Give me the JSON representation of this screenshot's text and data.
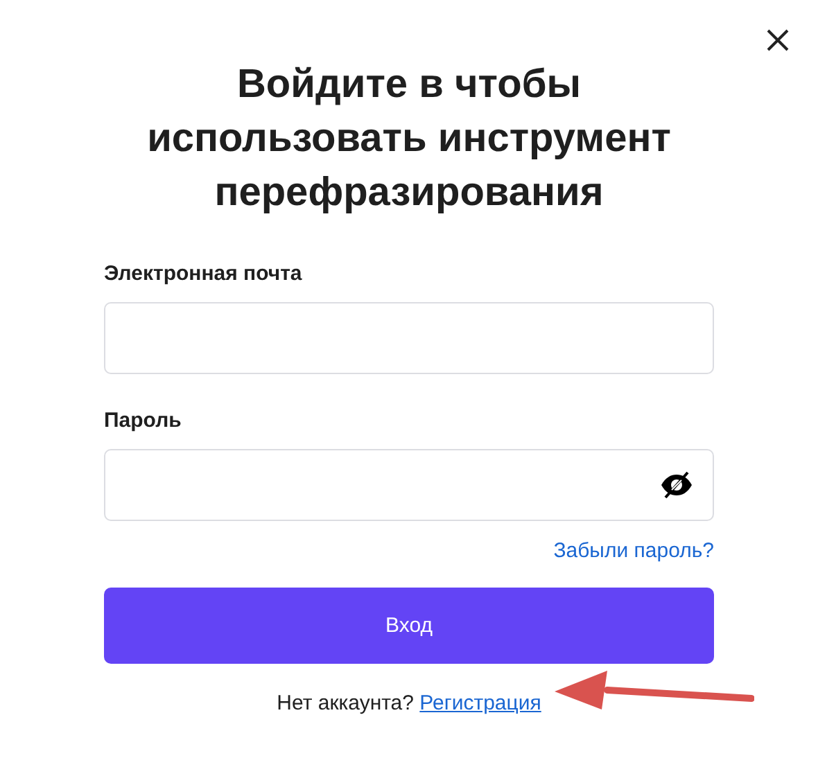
{
  "title": "Войдите в чтобы использовать инструмент перефразирования",
  "fields": [
    {
      "label": "Электронная почта",
      "kind": "email"
    },
    {
      "label": "Пароль",
      "kind": "password",
      "password_visible": false
    }
  ],
  "forgot_link": "Забыли пароль?",
  "submit_button": "Вход",
  "footer": {
    "text": "Нет аккаунта?",
    "link": "Регистрация"
  }
}
